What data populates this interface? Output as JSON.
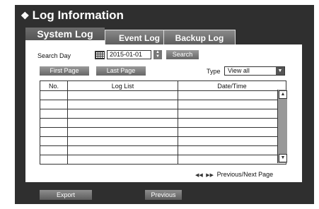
{
  "title": "Log Information",
  "tabs": [
    {
      "label": "System Log",
      "active": true
    },
    {
      "label": "Event Log",
      "active": false
    },
    {
      "label": "Backup Log",
      "active": false
    }
  ],
  "search": {
    "label": "Search Day",
    "date": "2015-01-01",
    "button": "Search"
  },
  "paging": {
    "first": "First Page",
    "last": "Last Page",
    "nav_label": "Previous/Next Page"
  },
  "type_filter": {
    "label": "Type",
    "value": "View all"
  },
  "table": {
    "columns": [
      "No.",
      "Log List",
      "Date/Time"
    ],
    "rows": [
      [
        "",
        "",
        ""
      ],
      [
        "",
        "",
        ""
      ],
      [
        "",
        "",
        ""
      ],
      [
        "",
        "",
        ""
      ],
      [
        "",
        "",
        ""
      ],
      [
        "",
        "",
        ""
      ],
      [
        "",
        "",
        ""
      ],
      [
        "",
        "",
        ""
      ]
    ]
  },
  "footer": {
    "export": "Export",
    "previous": "Previous"
  }
}
